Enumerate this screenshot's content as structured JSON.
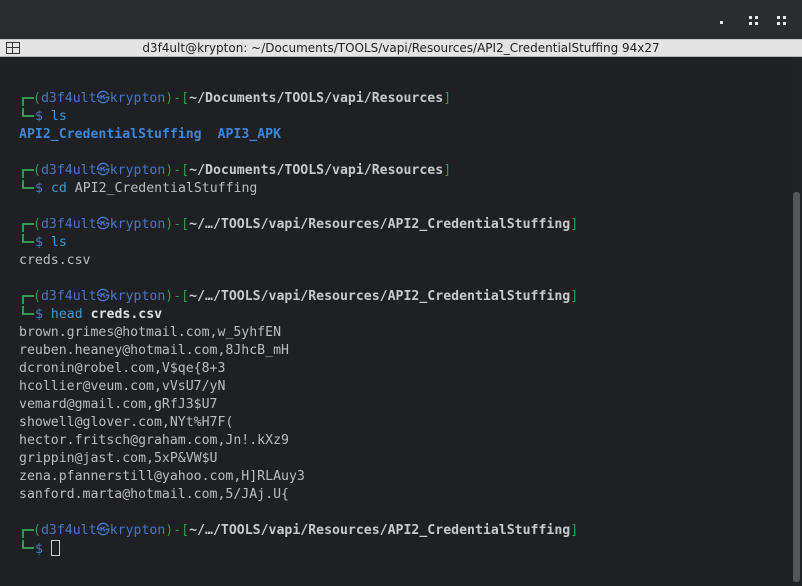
{
  "window": {
    "title": "d3f4ult@krypton: ~/Documents/TOOLS/vapi/Resources/API2_CredentialStuffing 94x27"
  },
  "prompt": {
    "user_host": "d3f4ult㉿krypton",
    "dollar": "$"
  },
  "blocks": [
    {
      "cwd": "~/Documents/TOOLS/vapi/Resources",
      "cmd": "ls",
      "cmd_arg": "",
      "output_dirs": [
        "API2_CredentialStuffing",
        "API3_APK"
      ]
    },
    {
      "cwd": "~/Documents/TOOLS/vapi/Resources",
      "cmd": "cd",
      "cmd_arg": "API2_CredentialStuffing"
    },
    {
      "cwd": "~/…/TOOLS/vapi/Resources/API2_CredentialStuffing",
      "cmd": "ls",
      "cmd_arg": "",
      "output": [
        "creds.csv"
      ]
    },
    {
      "cwd": "~/…/TOOLS/vapi/Resources/API2_CredentialStuffing",
      "cmd": "head",
      "cmd_arg": "creds.csv",
      "output": [
        "brown.grimes@hotmail.com,w_5yhfEN",
        "reuben.heaney@hotmail.com,8JhcB_mH",
        "dcronin@robel.com,V$qe{8+3",
        "hcollier@veum.com,vVsU7/yN",
        "vemard@gmail.com,gRfJ3$U7",
        "showell@glover.com,NYt%H7F(",
        "hector.fritsch@graham.com,Jn!.kXz9",
        "grippin@jast.com,5xP&VW$U",
        "zena.pfannerstill@yahoo.com,H]RLAuy3",
        "sanford.marta@hotmail.com,5/JAj.U{"
      ]
    },
    {
      "cwd": "~/…/TOOLS/vapi/Resources/API2_CredentialStuffing",
      "cmd": "",
      "cmd_arg": ""
    }
  ]
}
